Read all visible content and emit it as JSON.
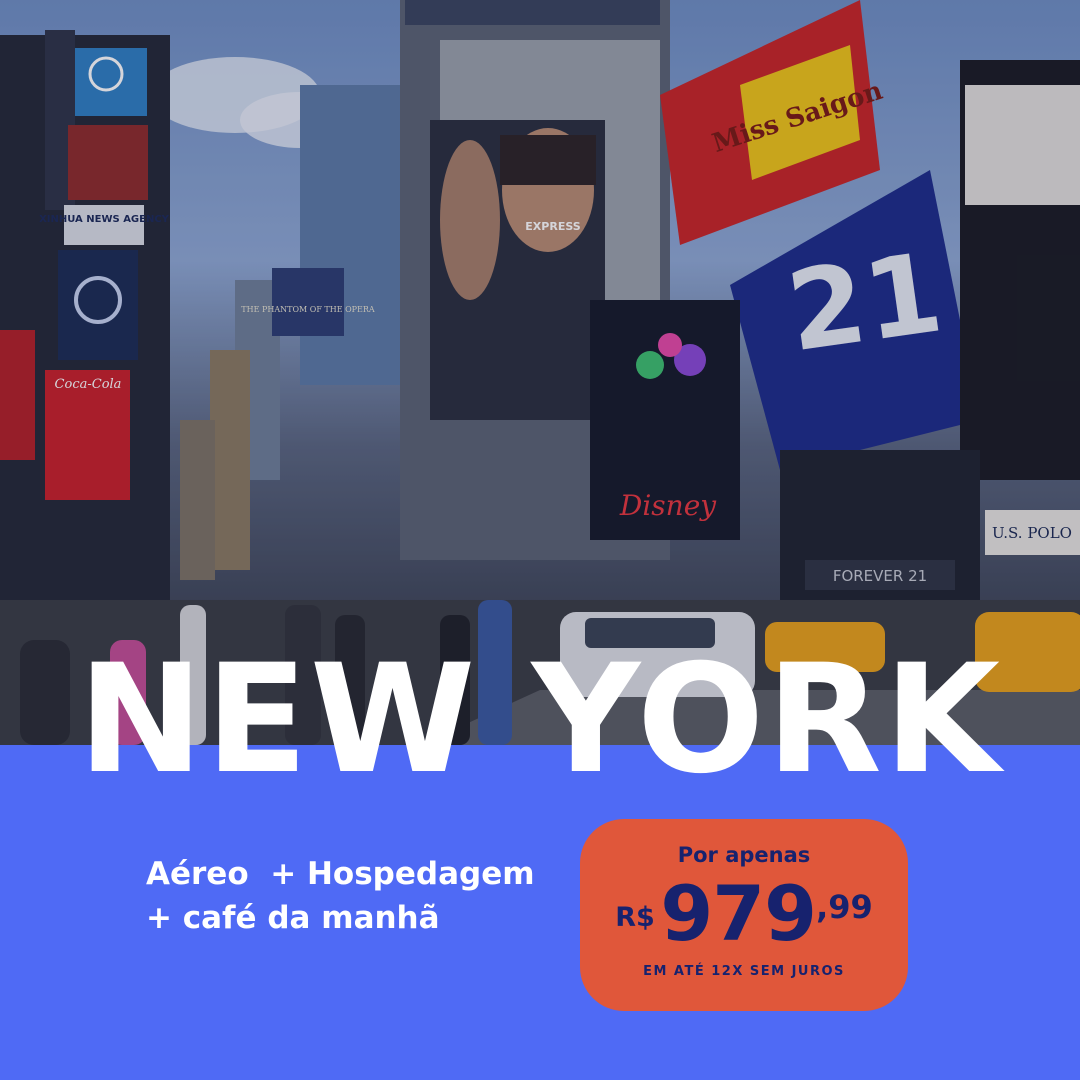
{
  "headline": "NEW YORK",
  "features": {
    "line1": "Aéreo  + Hospedagem",
    "line2": "+ café da manhã"
  },
  "price": {
    "label": "Por apenas",
    "currency": "R$",
    "integer": "979",
    "cents": ",99",
    "installments": "EM ATÉ 12X SEM JUROS"
  },
  "billboards": {
    "miss_saigon": "Miss Saigon",
    "forever21": "21",
    "forever21_store": "FOREVER 21",
    "uspolo": "U.S. POLO",
    "phantom": "THE PHANTOM OF THE OPERA",
    "xinhua": "XINHUA NEWS AGENCY",
    "cocacola": "Coca-Cola",
    "express": "EXPRESS",
    "disney": "Disney"
  },
  "colors": {
    "panel": "#4f6af5",
    "price_card": "#e0573a",
    "price_text": "#17226e",
    "headline": "#ffffff"
  }
}
